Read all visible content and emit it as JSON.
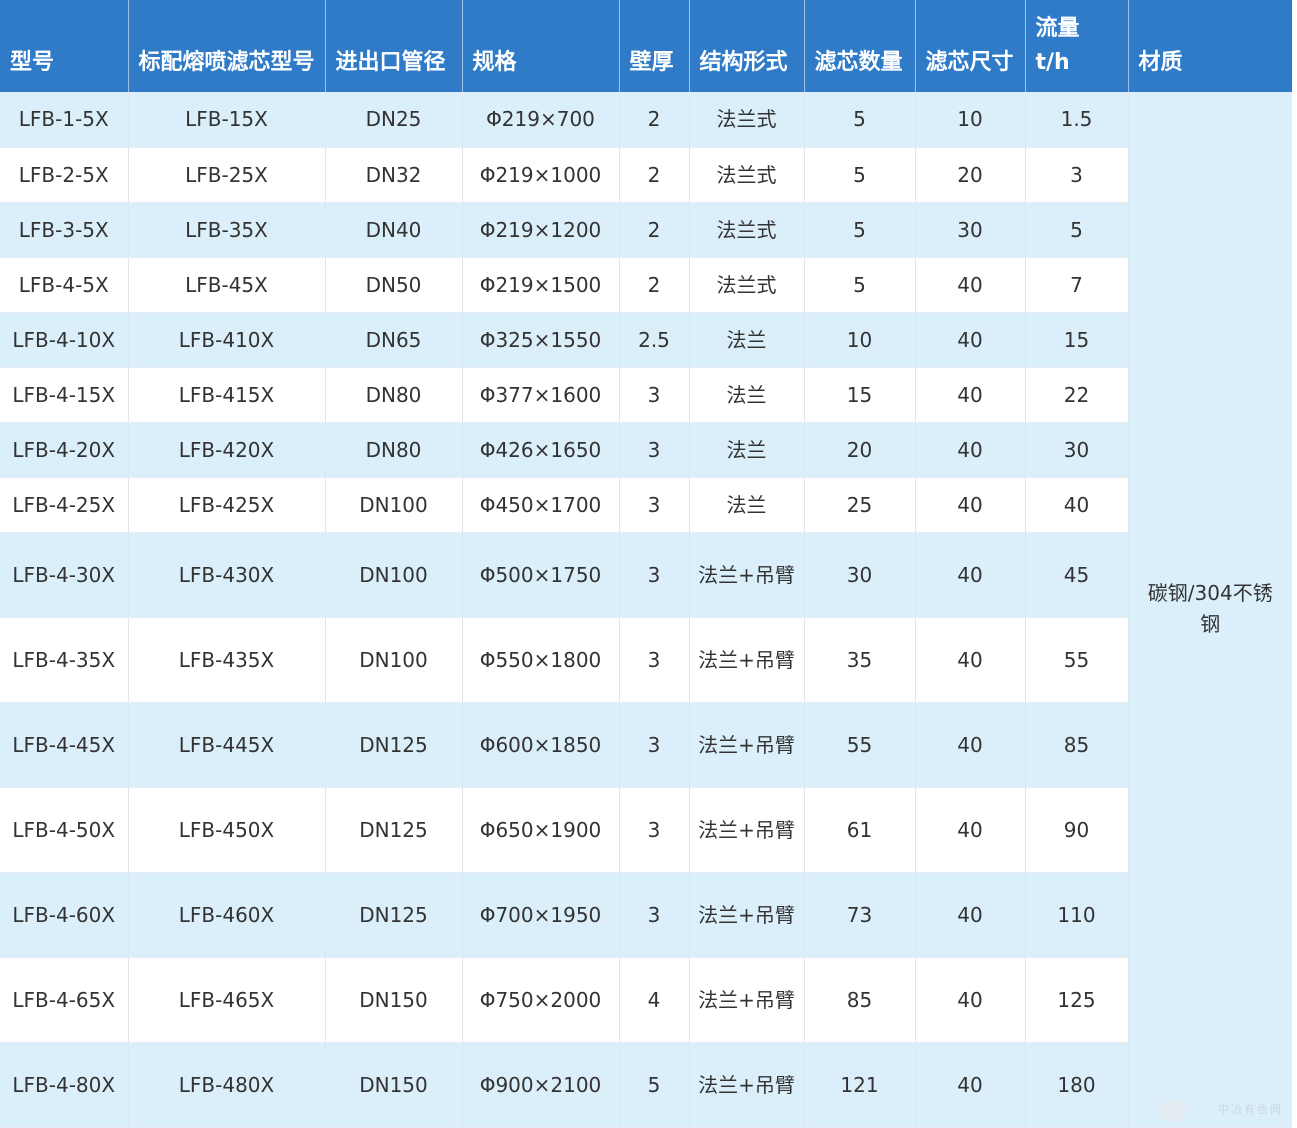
{
  "headers": [
    "型号",
    "标配熔喷滤芯型号",
    "进出口管径",
    "规格",
    "壁厚",
    "结构形式",
    "滤芯数量",
    "滤芯尺寸",
    "流量 t/h",
    "材质"
  ],
  "material": "碳钢/304不锈钢",
  "rows": [
    [
      "LFB-1-5X",
      "LFB-15X",
      "DN25",
      "Φ219×700",
      "2",
      "法兰式",
      "5",
      "10",
      "1.5"
    ],
    [
      "LFB-2-5X",
      "LFB-25X",
      "DN32",
      "Φ219×1000",
      "2",
      "法兰式",
      "5",
      "20",
      "3"
    ],
    [
      "LFB-3-5X",
      "LFB-35X",
      "DN40",
      "Φ219×1200",
      "2",
      "法兰式",
      "5",
      "30",
      "5"
    ],
    [
      "LFB-4-5X",
      "LFB-45X",
      "DN50",
      "Φ219×1500",
      "2",
      "法兰式",
      "5",
      "40",
      "7"
    ],
    [
      "LFB-4-10X",
      "LFB-410X",
      "DN65",
      "Φ325×1550",
      "2.5",
      "法兰",
      "10",
      "40",
      "15"
    ],
    [
      "LFB-4-15X",
      "LFB-415X",
      "DN80",
      "Φ377×1600",
      "3",
      "法兰",
      "15",
      "40",
      "22"
    ],
    [
      "LFB-4-20X",
      "LFB-420X",
      "DN80",
      "Φ426×1650",
      "3",
      "法兰",
      "20",
      "40",
      "30"
    ],
    [
      "LFB-4-25X",
      "LFB-425X",
      "DN100",
      "Φ450×1700",
      "3",
      "法兰",
      "25",
      "40",
      "40"
    ],
    [
      "LFB-4-30X",
      "LFB-430X",
      "DN100",
      "Φ500×1750",
      "3",
      "法兰+吊臂",
      "30",
      "40",
      "45"
    ],
    [
      "LFB-4-35X",
      "LFB-435X",
      "DN100",
      "Φ550×1800",
      "3",
      "法兰+吊臂",
      "35",
      "40",
      "55"
    ],
    [
      "LFB-4-45X",
      "LFB-445X",
      "DN125",
      "Φ600×1850",
      "3",
      "法兰+吊臂",
      "55",
      "40",
      "85"
    ],
    [
      "LFB-4-50X",
      "LFB-450X",
      "DN125",
      "Φ650×1900",
      "3",
      "法兰+吊臂",
      "61",
      "40",
      "90"
    ],
    [
      "LFB-4-60X",
      "LFB-460X",
      "DN125",
      "Φ700×1950",
      "3",
      "法兰+吊臂",
      "73",
      "40",
      "110"
    ],
    [
      "LFB-4-65X",
      "LFB-465X",
      "DN150",
      "Φ750×2000",
      "4",
      "法兰+吊臂",
      "85",
      "40",
      "125"
    ],
    [
      "LFB-4-80X",
      "LFB-480X",
      "DN150",
      "Φ900×2100",
      "5",
      "法兰+吊臂",
      "121",
      "40",
      "180"
    ]
  ],
  "watermark": "中冶有色网"
}
